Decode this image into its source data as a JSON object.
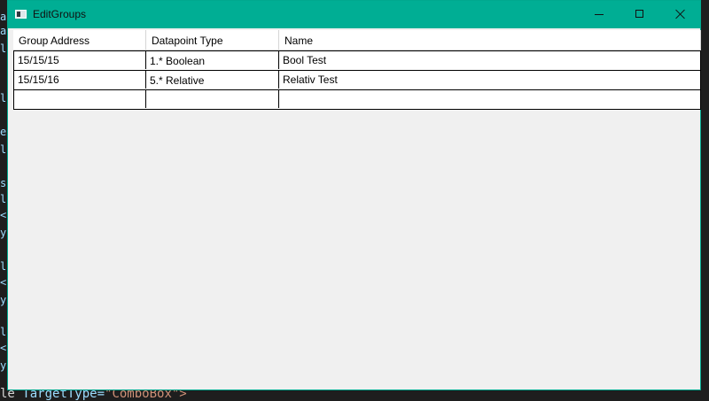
{
  "background": {
    "editor_fragments": [
      "al",
      "ar",
      "li",
      "lo",
      "ex",
      "le",
      "so",
      "le",
      "<s",
      "y.",
      "le",
      "<s",
      "y.",
      "le",
      "<s",
      "y."
    ],
    "bottom_line_prefix": "le ",
    "bottom_line_attr": "TargetType=",
    "bottom_line_value": "\"ComboBox\">"
  },
  "window": {
    "title": "EditGroups",
    "icon": "window-app-icon",
    "accent_color": "#00ae94"
  },
  "grid": {
    "columns": [
      "Group Address",
      "Datapoint Type",
      "Name"
    ],
    "rows": [
      [
        "15/15/15",
        "1.* Boolean",
        "Bool Test"
      ],
      [
        "15/15/16",
        "5.* Relative",
        "Relativ Test"
      ],
      [
        "",
        "",
        ""
      ]
    ]
  }
}
